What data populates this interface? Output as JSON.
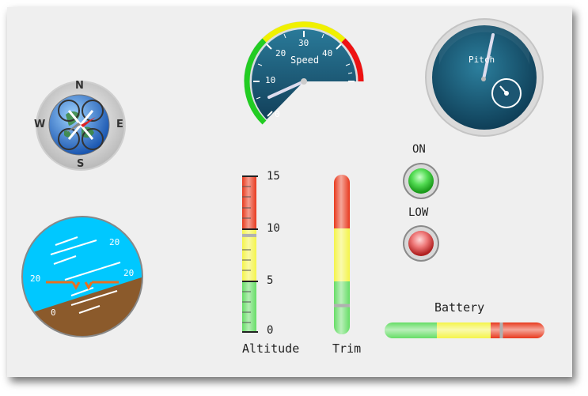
{
  "compass": {
    "north": "N",
    "south": "S",
    "east": "E",
    "west": "W"
  },
  "speed_gauge": {
    "label": "Speed",
    "ticks": [
      "0",
      "10",
      "20",
      "30",
      "40"
    ],
    "value": 11,
    "max": 48,
    "colors": {
      "green": "#22cc22",
      "yellow": "#f0f000",
      "red": "#ee1111",
      "face": "#1a5a73"
    }
  },
  "pitch_gauge": {
    "label": "Pitch"
  },
  "attitude": {
    "pitch_labels": [
      "20",
      "20",
      "20",
      "0"
    ],
    "sky_color": "#00c8ff",
    "ground_color": "#8b5a2b",
    "bank_deg": -15
  },
  "altitude": {
    "label": "Altitude",
    "scale": [
      "15",
      "10",
      "5",
      "0"
    ],
    "value_fraction": 0.62
  },
  "trim": {
    "label": "Trim",
    "value_fraction": 0.18
  },
  "indicators": [
    {
      "label": "ON",
      "state": "green"
    },
    {
      "label": "LOW",
      "state": "red"
    }
  ],
  "battery": {
    "label": "Battery",
    "value_fraction": 0.73
  }
}
